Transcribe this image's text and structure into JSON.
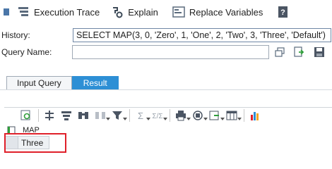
{
  "toolbar": {
    "execution_trace_label": "Execution Trace",
    "explain_label": "Explain",
    "replace_variables_label": "Replace Variables"
  },
  "history": {
    "label": "History:",
    "value": "SELECT MAP(3, 0, 'Zero', 1, 'One', 2, 'Two', 3, 'Three', 'Default')"
  },
  "query_name": {
    "label": "Query Name:",
    "value": ""
  },
  "tabs": [
    {
      "label": "Input Query",
      "active": false
    },
    {
      "label": "Result",
      "active": true
    }
  ],
  "result": {
    "columns": [
      "MAP"
    ],
    "rows": [
      [
        "Three"
      ]
    ]
  },
  "colors": {
    "active_tab": "#2d8fd5",
    "highlight_border": "#e0202a"
  }
}
